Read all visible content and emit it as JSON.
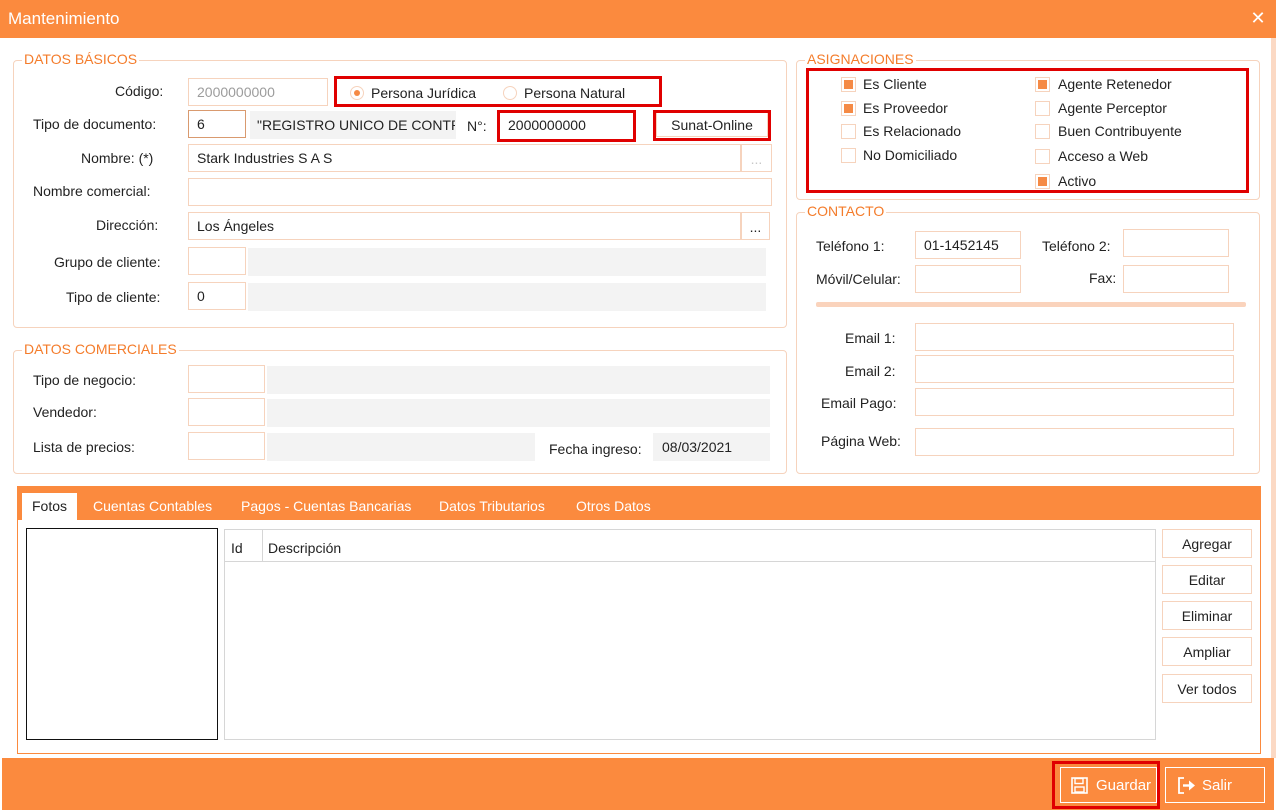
{
  "window": {
    "title": "Mantenimiento",
    "close_glyph": "✕"
  },
  "datos_basicos": {
    "legend": "DATOS BÁSICOS",
    "codigo_label": "Código:",
    "codigo_value": "2000000000",
    "persona_juridica": "Persona Jurídica",
    "persona_natural": "Persona Natural",
    "tipo_doc_label": "Tipo de documento:",
    "tipo_doc_code": "6",
    "tipo_doc_desc": "\"REGISTRO UNICO DE CONTR",
    "numero_label": "N°:",
    "numero_value": "2000000000",
    "sunat_button": "Sunat-Online",
    "nombre_label": "Nombre: (*)",
    "nombre_value": "Stark Industries S A S",
    "nombre_browse": "...",
    "nombre_comercial_label": "Nombre comercial:",
    "direccion_label": "Dirección:",
    "direccion_value": "Los Ángeles",
    "direccion_browse": "...",
    "grupo_label": "Grupo de cliente:",
    "tipo_cliente_label": "Tipo de cliente:",
    "tipo_cliente_value": "0"
  },
  "asignaciones": {
    "legend": "ASIGNACIONES",
    "items": [
      {
        "label": "Es Cliente",
        "checked": true
      },
      {
        "label": "Es Proveedor",
        "checked": true
      },
      {
        "label": "Es Relacionado",
        "checked": false
      },
      {
        "label": "No Domiciliado",
        "checked": false
      },
      {
        "label": "Agente Retenedor",
        "checked": true
      },
      {
        "label": "Agente Perceptor",
        "checked": false
      },
      {
        "label": "Buen Contribuyente",
        "checked": false
      },
      {
        "label": "Acceso a Web",
        "checked": false
      },
      {
        "label": "Activo",
        "checked": true
      }
    ]
  },
  "contacto": {
    "legend": "CONTACTO",
    "telefono1_label": "Teléfono 1:",
    "telefono1_value": "01-1452145",
    "telefono2_label": "Teléfono 2:",
    "movil_label": "Móvil/Celular:",
    "fax_label": "Fax:",
    "email1_label": "Email 1:",
    "email2_label": "Email 2:",
    "email_pago_label": "Email Pago:",
    "pagina_web_label": "Página Web:"
  },
  "datos_comerciales": {
    "legend": "DATOS COMERCIALES",
    "tipo_negocio_label": "Tipo de negocio:",
    "vendedor_label": "Vendedor:",
    "lista_precios_label": "Lista de precios:",
    "fecha_ingreso_label": "Fecha ingreso:",
    "fecha_ingreso_value": "08/03/2021"
  },
  "tabs": [
    "Fotos",
    "Cuentas Contables",
    "Pagos - Cuentas Bancarias",
    "Datos Tributarios",
    "Otros Datos"
  ],
  "grid": {
    "columns": [
      "Id",
      "Descripción"
    ]
  },
  "side_buttons": [
    "Agregar",
    "Editar",
    "Eliminar",
    "Ampliar",
    "Ver todos"
  ],
  "footer": {
    "guardar": "Guardar",
    "salir": "Salir"
  },
  "colors": {
    "accent": "#fb8a3e",
    "highlight_border": "#e00000",
    "field_border": "#f6d3bd"
  }
}
